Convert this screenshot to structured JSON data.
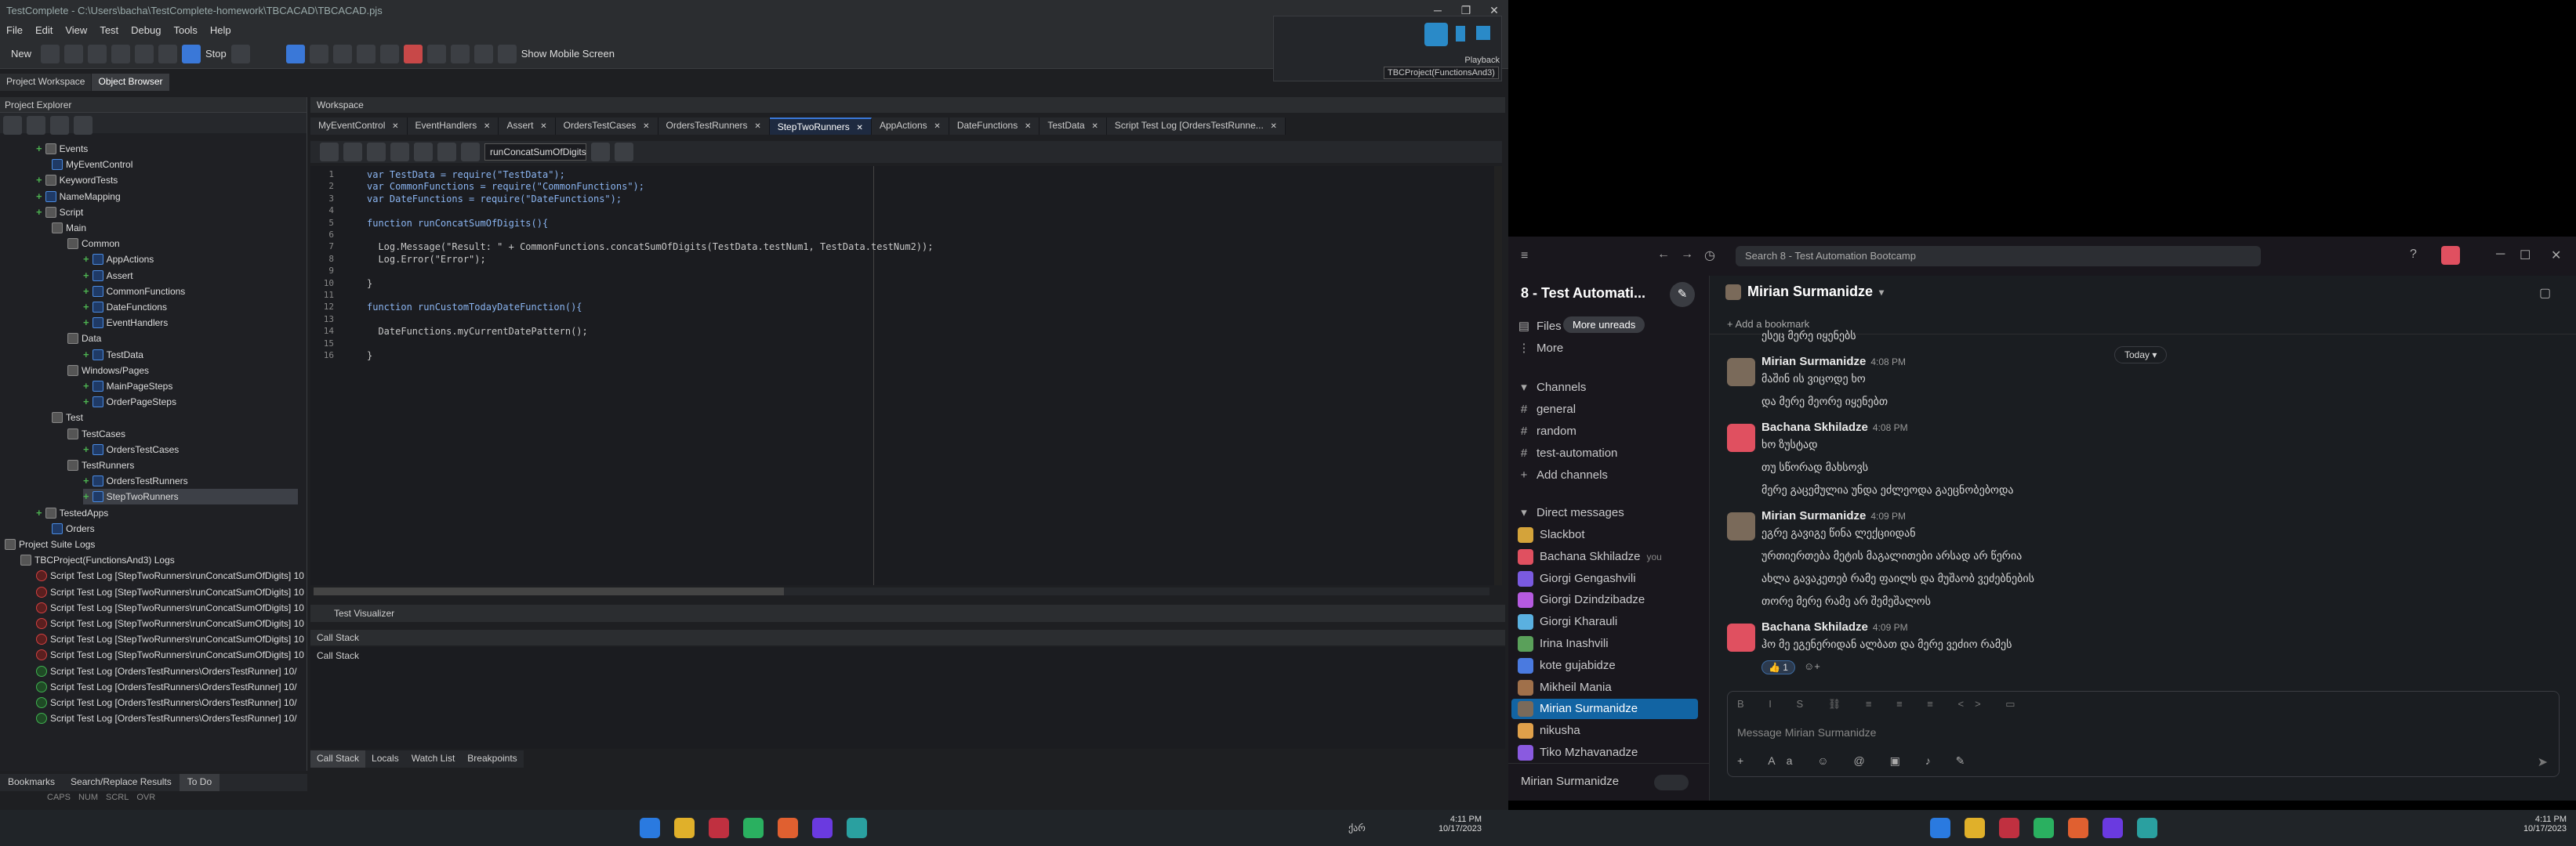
{
  "testcomplete": {
    "title": "TestComplete - C:\\Users\\bacha\\TestComplete-homework\\TBCACAD\\TBCACAD.pjs",
    "menu": [
      "File",
      "Edit",
      "View",
      "Test",
      "Debug",
      "Tools",
      "Help"
    ],
    "toolbar": {
      "new_label": "New",
      "stop_label": "Stop",
      "show_mobile_label": "Show Mobile Screen"
    },
    "playback": {
      "label": "Playback",
      "project": "TBCProject(FunctionsAnd3)"
    },
    "left_tabs": [
      "Project Workspace",
      "Object Browser"
    ],
    "project_explorer_title": "Project Explorer",
    "tree": [
      {
        "label": "Events",
        "depth": 2,
        "type": "fold",
        "plus": true
      },
      {
        "label": "MyEventControl",
        "depth": 3,
        "type": "item"
      },
      {
        "label": "KeywordTests",
        "depth": 2,
        "type": "fold",
        "plus": true
      },
      {
        "label": "NameMapping",
        "depth": 2,
        "type": "item",
        "plus": true
      },
      {
        "label": "Script",
        "depth": 2,
        "type": "fold",
        "plus": true
      },
      {
        "label": "Main",
        "depth": 3,
        "type": "fold"
      },
      {
        "label": "Common",
        "depth": 4,
        "type": "fold"
      },
      {
        "label": "AppActions",
        "depth": 5,
        "type": "item",
        "plus": true
      },
      {
        "label": "Assert",
        "depth": 5,
        "type": "item",
        "plus": true
      },
      {
        "label": "CommonFunctions",
        "depth": 5,
        "type": "item",
        "plus": true
      },
      {
        "label": "DateFunctions",
        "depth": 5,
        "type": "item",
        "plus": true
      },
      {
        "label": "EventHandlers",
        "depth": 5,
        "type": "item",
        "plus": true
      },
      {
        "label": "Data",
        "depth": 4,
        "type": "fold"
      },
      {
        "label": "TestData",
        "depth": 5,
        "type": "item",
        "plus": true
      },
      {
        "label": "Windows/Pages",
        "depth": 4,
        "type": "fold"
      },
      {
        "label": "MainPageSteps",
        "depth": 5,
        "type": "item",
        "plus": true
      },
      {
        "label": "OrderPageSteps",
        "depth": 5,
        "type": "item",
        "plus": true
      },
      {
        "label": "Test",
        "depth": 3,
        "type": "fold"
      },
      {
        "label": "TestCases",
        "depth": 4,
        "type": "fold"
      },
      {
        "label": "OrdersTestCases",
        "depth": 5,
        "type": "item",
        "plus": true
      },
      {
        "label": "TestRunners",
        "depth": 4,
        "type": "fold"
      },
      {
        "label": "OrdersTestRunners",
        "depth": 5,
        "type": "item",
        "plus": true
      },
      {
        "label": "StepTwoRunners",
        "depth": 5,
        "type": "item",
        "plus": true,
        "selected": true
      },
      {
        "label": "TestedApps",
        "depth": 2,
        "type": "fold",
        "plus": true
      },
      {
        "label": "Orders",
        "depth": 3,
        "type": "item"
      },
      {
        "label": "Project Suite Logs",
        "depth": 0,
        "type": "fold"
      },
      {
        "label": "TBCProject(FunctionsAnd3) Logs",
        "depth": 1,
        "type": "fold"
      },
      {
        "label": "Script Test Log [StepTwoRunners\\runConcatSumOfDigits] 10",
        "depth": 2,
        "type": "log-r"
      },
      {
        "label": "Script Test Log [StepTwoRunners\\runConcatSumOfDigits] 10",
        "depth": 2,
        "type": "log-r"
      },
      {
        "label": "Script Test Log [StepTwoRunners\\runConcatSumOfDigits] 10",
        "depth": 2,
        "type": "log-r"
      },
      {
        "label": "Script Test Log [StepTwoRunners\\runConcatSumOfDigits] 10",
        "depth": 2,
        "type": "log-r"
      },
      {
        "label": "Script Test Log [StepTwoRunners\\runConcatSumOfDigits] 10",
        "depth": 2,
        "type": "log-r"
      },
      {
        "label": "Script Test Log [StepTwoRunners\\runConcatSumOfDigits] 10",
        "depth": 2,
        "type": "log-r"
      },
      {
        "label": "Script Test Log [OrdersTestRunners\\OrdersTestRunner] 10/",
        "depth": 2,
        "type": "log-g"
      },
      {
        "label": "Script Test Log [OrdersTestRunners\\OrdersTestRunner] 10/",
        "depth": 2,
        "type": "log-g"
      },
      {
        "label": "Script Test Log [OrdersTestRunners\\OrdersTestRunner] 10/",
        "depth": 2,
        "type": "log-g"
      },
      {
        "label": "Script Test Log [OrdersTestRunners\\OrdersTestRunner] 10/",
        "depth": 2,
        "type": "log-g"
      }
    ],
    "bottom_left_tabs": [
      "Bookmarks",
      "Search/Replace Results",
      "To Do"
    ],
    "status_keys": [
      "CAPS",
      "NUM",
      "SCRL",
      "OVR"
    ],
    "workspace_title": "Workspace",
    "editor_tabs": [
      "MyEventControl",
      "EventHandlers",
      "Assert",
      "OrdersTestCases",
      "OrdersTestRunners",
      "StepTwoRunners",
      "AppActions",
      "DateFunctions",
      "TestData",
      "Script Test Log [OrdersTestRunne..."
    ],
    "active_tab": "StepTwoRunners",
    "function_dropdown": "runConcatSumOfDigits",
    "code_lines": [
      "var TestData = require(\"TestData\");",
      "var CommonFunctions = require(\"CommonFunctions\");",
      "var DateFunctions = require(\"DateFunctions\");",
      "",
      "function runConcatSumOfDigits(){",
      "",
      "  Log.Message(\"Result: \" + CommonFunctions.concatSumOfDigits(TestData.testNum1, TestData.testNum2));",
      "  Log.Error(\"Error\");",
      "",
      "}",
      "",
      "function runCustomTodayDateFunction(){",
      "",
      "  DateFunctions.myCurrentDatePattern();",
      "",
      "}"
    ],
    "test_visualizer": "Test Visualizer",
    "call_stack_title": "Call Stack",
    "call_stack_header": "Call Stack",
    "bottom_tabs": [
      "Call Stack",
      "Locals",
      "Watch List",
      "Breakpoints"
    ],
    "taskbar_clock": {
      "time": "4:11 PM",
      "date": "10/17/2023"
    },
    "taskbar_lang": "ქარ"
  },
  "slack": {
    "search_placeholder": "Search 8 - Test Automation Bootcamp",
    "workspace": "8 - Test Automati...",
    "more_unreads": "More unreads",
    "files_label": "Files",
    "more_label": "More",
    "channels_label": "Channels",
    "channels": [
      "general",
      "random",
      "test-automation"
    ],
    "add_channels": "Add channels",
    "dm_label": "Direct messages",
    "dms": [
      {
        "name": "Slackbot",
        "color": "#d4a33a"
      },
      {
        "name": "Bachana Skhiladze",
        "suffix": "you",
        "color": "#e05060"
      },
      {
        "name": "Giorgi Gengashvili",
        "color": "#7a5ae0"
      },
      {
        "name": "Giorgi Dzindzibadze",
        "color": "#b55ae0"
      },
      {
        "name": "Giorgi Kharauli",
        "color": "#5ab0e0"
      },
      {
        "name": "Irina Inashvili",
        "color": "#5aa05a"
      },
      {
        "name": "kote gujabidze",
        "color": "#4a7ae0"
      },
      {
        "name": "Mikheil Mania",
        "color": "#a0704a"
      },
      {
        "name": "Mirian Surmanidze",
        "color": "#7a6a5a",
        "active": true
      },
      {
        "name": "nikusha",
        "color": "#e0a04a"
      },
      {
        "name": "Tiko Mzhavanadze",
        "color": "#8a5ae0"
      }
    ],
    "current_user": "Mirian Surmanidze",
    "channel_header": "Mirian Surmanidze",
    "add_bookmark": "Add a bookmark",
    "date_divider": "Today",
    "messages": [
      {
        "author": "",
        "time": "",
        "lines": [
          "ესეც მერე იყენებს"
        ],
        "cont": true
      },
      {
        "author": "Mirian Surmanidze",
        "time": "4:08 PM",
        "lines": [
          "მაშინ ის ვიცოდე ხო",
          "და მერე მეორე იყენებთ"
        ],
        "avatar": "#7a6a5a"
      },
      {
        "author": "Bachana Skhiladze",
        "time": "4:08 PM",
        "lines": [
          "ხო ზუსტად",
          "თუ სწორად მახსოვს",
          "მერე გაცემულია უნდა ეძლეოდა გაეცნობებოდა"
        ],
        "avatar": "#e05060"
      },
      {
        "author": "Mirian Surmanidze",
        "time": "4:09 PM",
        "lines": [
          "ეგრე გავიგე წინა ლექციიდან",
          "ურთიერთება მეტის მაგალითები არსად არ წერია",
          "ახლა გავაკეთებ რამე ფაილს და მუშაობ ვეძებნების",
          "თორე მერე რამე არ შემეშალოს"
        ],
        "avatar": "#7a6a5a"
      },
      {
        "author": "Bachana Skhiladze",
        "time": "4:09 PM",
        "lines": [
          "ჰო მე ეგენერიდან ალბათ და მერე ვეძიო რამეს"
        ],
        "avatar": "#e05060",
        "reaction": "👍 1"
      }
    ],
    "composer_placeholder": "Message Mirian Surmanidze",
    "taskbar_clock": {
      "time": "4:11 PM",
      "date": "10/17/2023"
    }
  }
}
